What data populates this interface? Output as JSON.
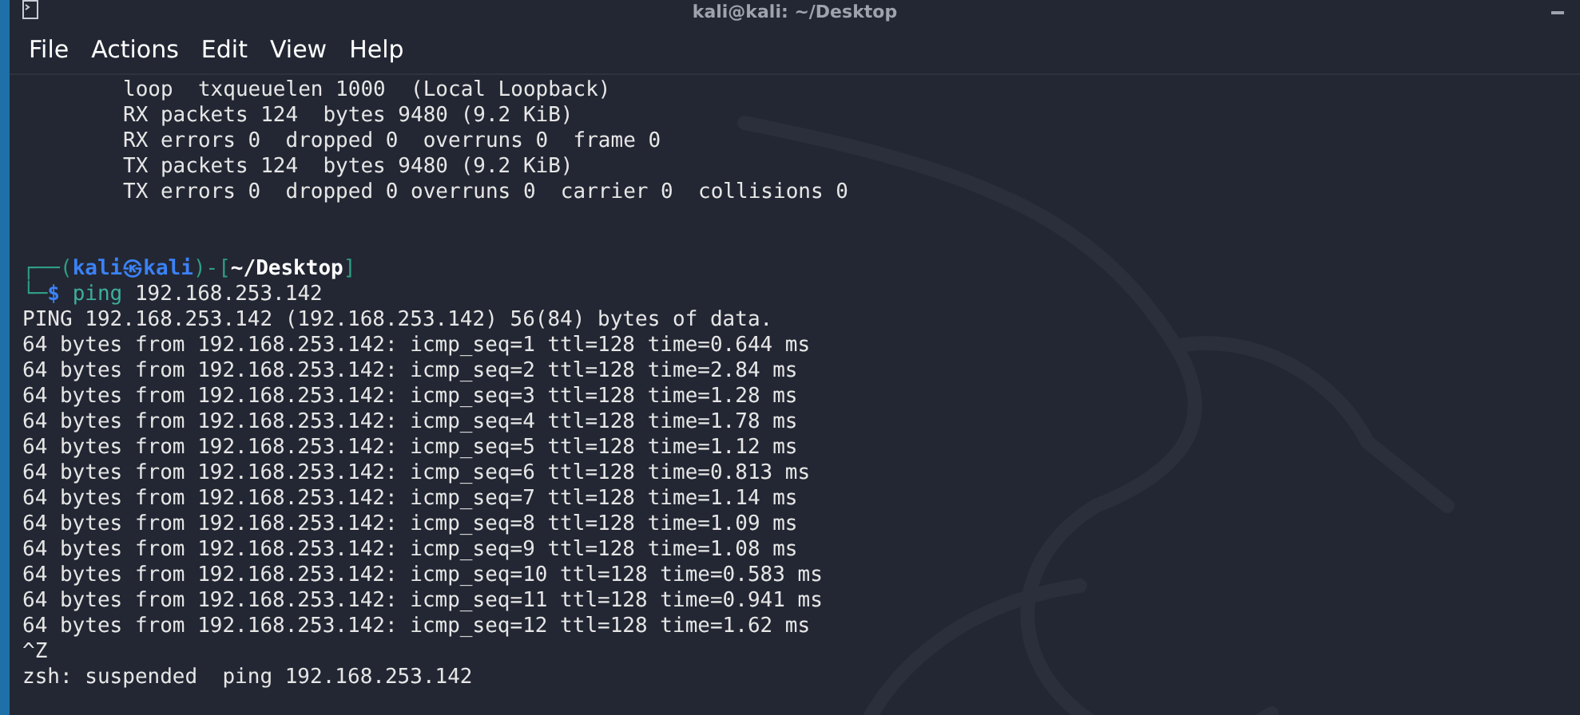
{
  "window": {
    "title": "kali@kali: ~/Desktop"
  },
  "menu": [
    "File",
    "Actions",
    "Edit",
    "View",
    "Help"
  ],
  "lines": [
    {
      "kind": "indented",
      "text": "loop  txqueuelen 1000  (Local Loopback)"
    },
    {
      "kind": "indented",
      "text": "RX packets 124  bytes 9480 (9.2 KiB)"
    },
    {
      "kind": "indented",
      "text": "RX errors 0  dropped 0  overruns 0  frame 0"
    },
    {
      "kind": "indented",
      "text": "TX packets 124  bytes 9480 (9.2 KiB)"
    },
    {
      "kind": "indented",
      "text": "TX errors 0  dropped 0 overruns 0  carrier 0  collisions 0"
    },
    {
      "kind": "blank"
    },
    {
      "kind": "blank"
    },
    {
      "kind": "prompt-header",
      "corner": "┌──(",
      "user": "kali",
      "symbol": "㉿",
      "host": "kali",
      "sep": ")-[",
      "path": "~/Desktop",
      "close": "]"
    },
    {
      "kind": "prompt-command",
      "corner": "└─",
      "dollar": "$",
      "command": "ping",
      "args": "192.168.253.142"
    },
    {
      "kind": "output",
      "text": "PING 192.168.253.142 (192.168.253.142) 56(84) bytes of data."
    },
    {
      "kind": "output",
      "text": "64 bytes from 192.168.253.142: icmp_seq=1 ttl=128 time=0.644 ms"
    },
    {
      "kind": "output",
      "text": "64 bytes from 192.168.253.142: icmp_seq=2 ttl=128 time=2.84 ms"
    },
    {
      "kind": "output",
      "text": "64 bytes from 192.168.253.142: icmp_seq=3 ttl=128 time=1.28 ms"
    },
    {
      "kind": "output",
      "text": "64 bytes from 192.168.253.142: icmp_seq=4 ttl=128 time=1.78 ms"
    },
    {
      "kind": "output",
      "text": "64 bytes from 192.168.253.142: icmp_seq=5 ttl=128 time=1.12 ms"
    },
    {
      "kind": "output",
      "text": "64 bytes from 192.168.253.142: icmp_seq=6 ttl=128 time=0.813 ms"
    },
    {
      "kind": "output",
      "text": "64 bytes from 192.168.253.142: icmp_seq=7 ttl=128 time=1.14 ms"
    },
    {
      "kind": "output",
      "text": "64 bytes from 192.168.253.142: icmp_seq=8 ttl=128 time=1.09 ms"
    },
    {
      "kind": "output",
      "text": "64 bytes from 192.168.253.142: icmp_seq=9 ttl=128 time=1.08 ms"
    },
    {
      "kind": "output",
      "text": "64 bytes from 192.168.253.142: icmp_seq=10 ttl=128 time=0.583 ms"
    },
    {
      "kind": "output",
      "text": "64 bytes from 192.168.253.142: icmp_seq=11 ttl=128 time=0.941 ms"
    },
    {
      "kind": "output",
      "text": "64 bytes from 192.168.253.142: icmp_seq=12 ttl=128 time=1.62 ms"
    },
    {
      "kind": "output",
      "text": "^Z"
    },
    {
      "kind": "output",
      "text": "zsh: suspended  ping 192.168.253.142"
    }
  ]
}
